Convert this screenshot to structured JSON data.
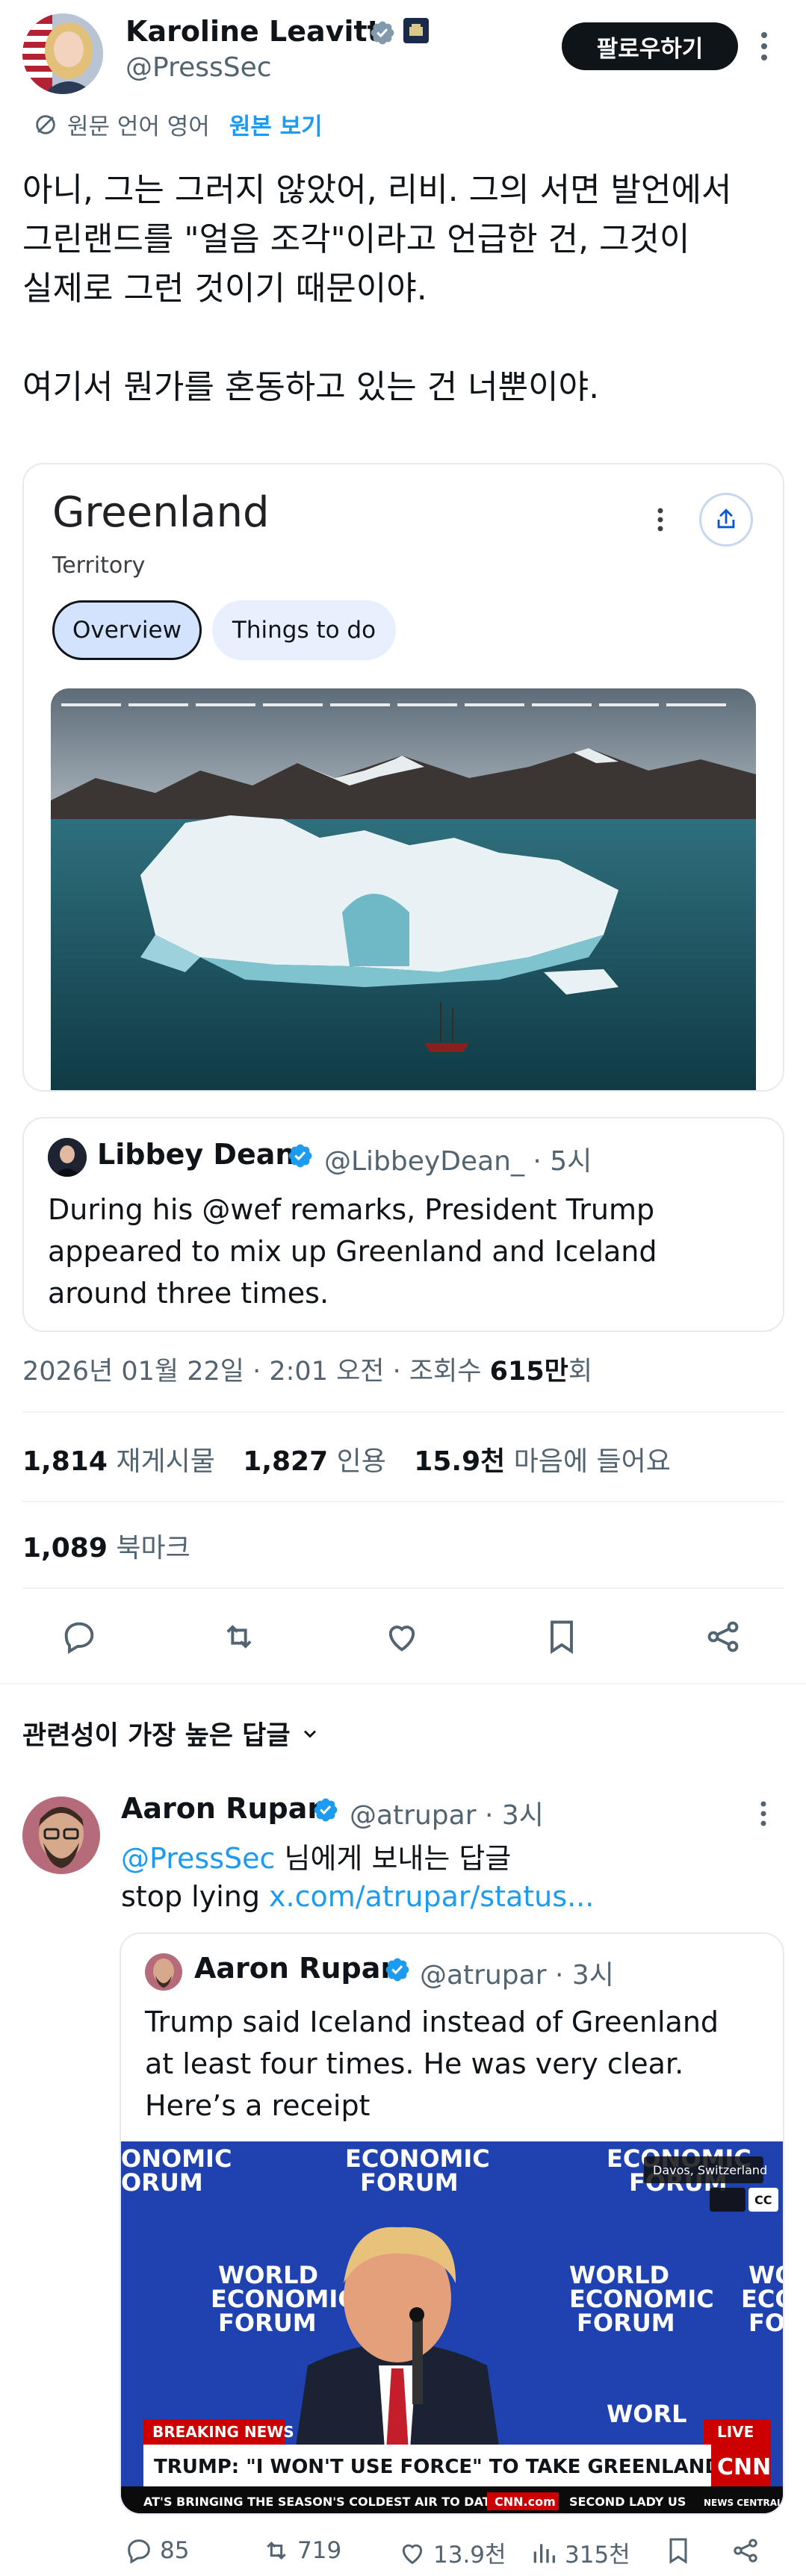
{
  "author": {
    "name": "Karoline Leavitt",
    "handle": "@PressSec",
    "follow_label": "팔로우하기"
  },
  "translation": {
    "source_label": "원문 언어 영어",
    "show_original": "원본 보기"
  },
  "tweet": {
    "text": "아니, 그는 그러지 않았어, 리비. 그의 서면 발언에서\n그린랜드를 \"얼음 조각\"이라고 언급한 건, 그것이\n실제로 그런 것이기 때문이야.\n\n여기서 뭔가를 혼동하고 있는 건 너뿐이야."
  },
  "google_card": {
    "title": "Greenland",
    "subtitle": "Territory",
    "tabs": [
      {
        "label": "Overview",
        "active": true
      },
      {
        "label": "Things to do",
        "active": false
      }
    ]
  },
  "quoted": {
    "name": "Libbey Dean",
    "handle": "@LibbeyDean_",
    "time": "· 5시",
    "text": "During his @wef remarks, President Trump\nappeared to mix up Greenland and Iceland\naround three times."
  },
  "meta": {
    "date": "2026년 01월 22일 · 2:01 오전 · 조회수 ",
    "views": "615만",
    "views_suffix": "회"
  },
  "stats": {
    "retweets": "1,814",
    "retweets_label": "재게시물",
    "quotes": "1,827",
    "quotes_label": "인용",
    "likes": "15.9천",
    "likes_label": "마음에 들어요",
    "bookmarks": "1,089",
    "bookmarks_label": "북마크"
  },
  "sort": {
    "label": "관련성이 가장 높은 답글"
  },
  "reply": {
    "name": "Aaron Rupar",
    "handle": "@atrupar",
    "time": "· 3시",
    "reply_to_handle": "@PressSec",
    "reply_to_suffix": " 님에게 보내는 답글",
    "text": "stop lying ",
    "link": "x.com/atrupar/status...",
    "quoted": {
      "name": "Aaron Rupar",
      "handle": "@atrupar",
      "time": "· 3시",
      "text": "Trump said Iceland instead of Greenland\nat least four times. He was very clear.\nHere’s a receipt"
    },
    "video": {
      "banner_tag": "BREAKING NEWS",
      "headline": "TRUMP: \"I WON'T USE FORCE\" TO TAKE GREENLAND",
      "live": "LIVE",
      "network": "CNN",
      "ticker_left": "AT'S BRINGING THE SEASON'S COLDEST AIR TO DATE.",
      "ticker_url": "CNN.com",
      "ticker_right": "SECOND LADY US",
      "ticker_end": "NEWS CENTRAL",
      "location": "Davos, Switzerland",
      "forum_label": "ECONOMIC FORUM",
      "world_label": "WORLD ECONOMIC FORUM",
      "cc": "CC"
    },
    "actions": {
      "replies": "85",
      "retweets": "719",
      "likes": "13.9천",
      "views": "315천"
    }
  },
  "colors": {
    "accent": "#1d9bf0",
    "text": "#0f1419",
    "muted": "#536471",
    "verified": "#1d9bf0",
    "cnn_red": "#cc0000"
  }
}
